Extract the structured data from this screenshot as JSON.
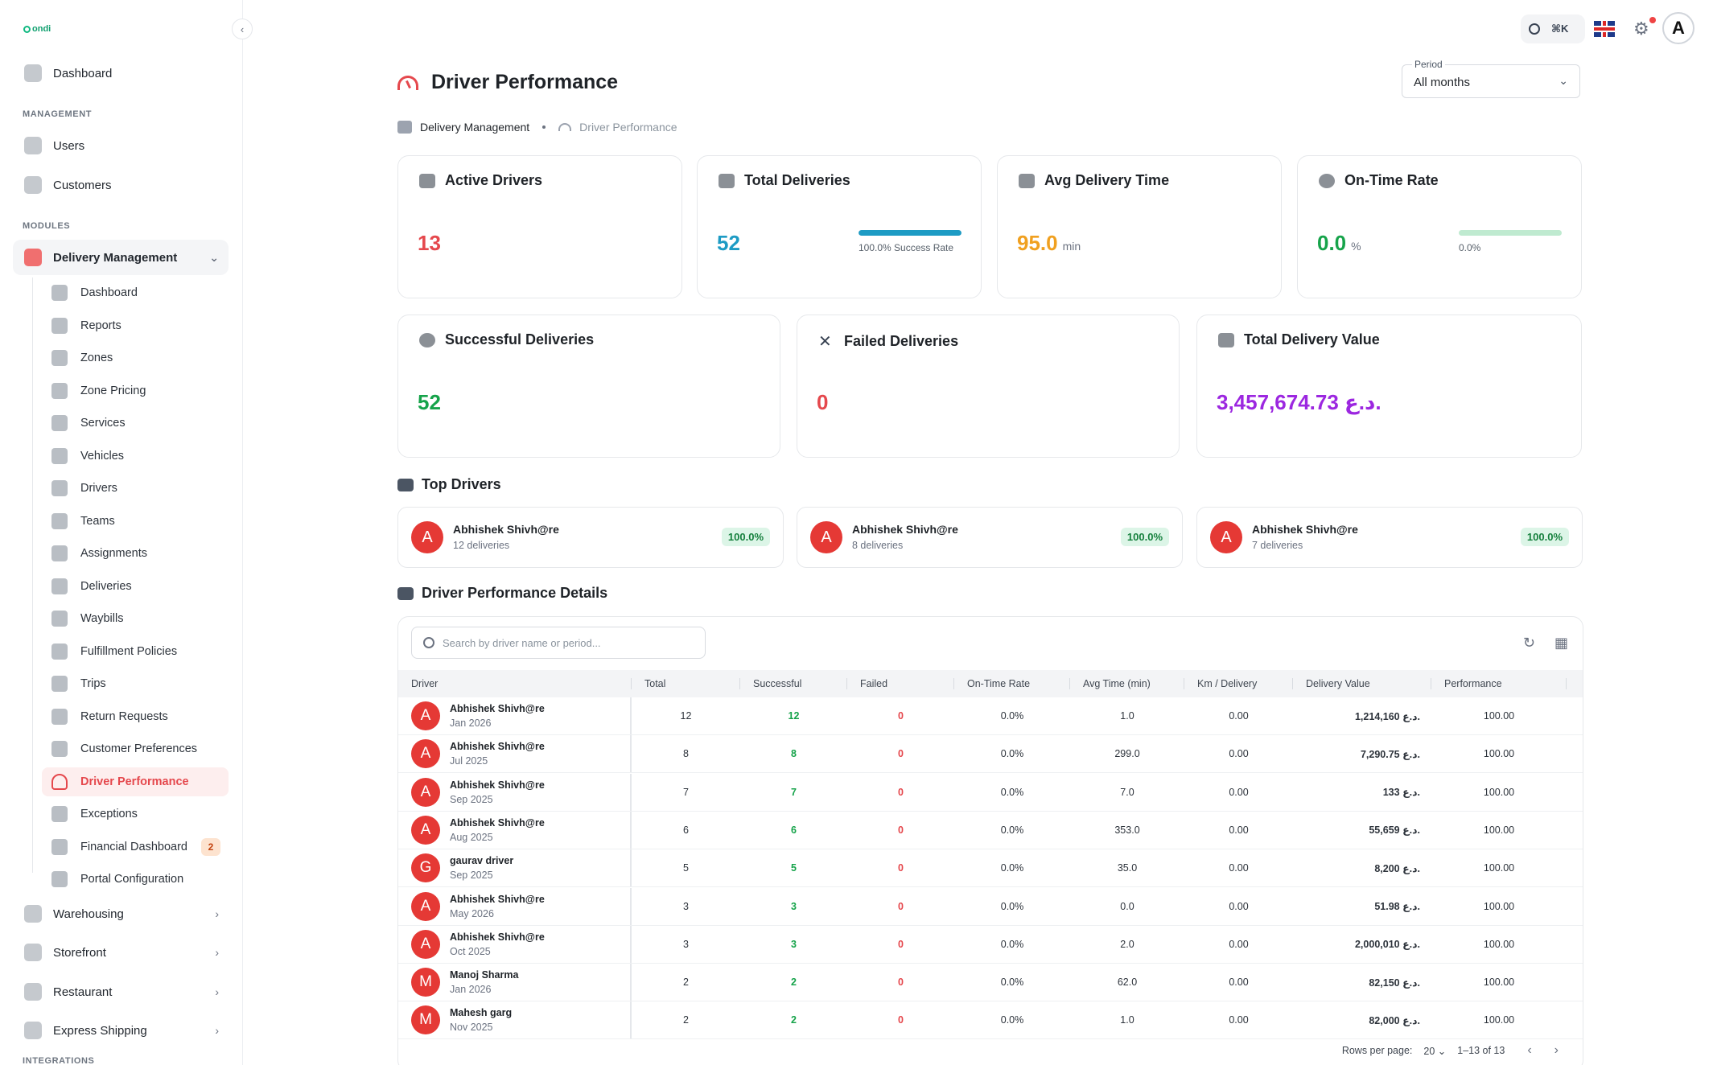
{
  "brand": {
    "logo_text": "ondi"
  },
  "sidebar": {
    "dashboard": "Dashboard",
    "management_label": "MANAGEMENT",
    "users": "Users",
    "customers": "Customers",
    "modules_label": "MODULES",
    "delivery_management": "Delivery Management",
    "sub_items": [
      {
        "label": "Dashboard"
      },
      {
        "label": "Reports"
      },
      {
        "label": "Zones"
      },
      {
        "label": "Zone Pricing"
      },
      {
        "label": "Services"
      },
      {
        "label": "Vehicles"
      },
      {
        "label": "Drivers"
      },
      {
        "label": "Teams"
      },
      {
        "label": "Assignments"
      },
      {
        "label": "Deliveries"
      },
      {
        "label": "Waybills"
      },
      {
        "label": "Fulfillment Policies"
      },
      {
        "label": "Trips"
      },
      {
        "label": "Return Requests"
      },
      {
        "label": "Customer Preferences"
      },
      {
        "label": "Driver Performance"
      },
      {
        "label": "Exceptions"
      },
      {
        "label": "Financial Dashboard",
        "badge": "2"
      },
      {
        "label": "Portal Configuration"
      }
    ],
    "warehousing": "Warehousing",
    "storefront": "Storefront",
    "restaurant": "Restaurant",
    "express_shipping": "Express Shipping",
    "integrations_label": "INTEGRATIONS"
  },
  "topbar": {
    "shortcut": "⌘K",
    "avatar_letter": "A"
  },
  "header": {
    "title": "Driver Performance",
    "period_label": "Period",
    "period_value": "All months"
  },
  "breadcrumb": {
    "parent": "Delivery Management",
    "current": "Driver Performance"
  },
  "stats": {
    "active_drivers": {
      "label": "Active Drivers",
      "value": "13"
    },
    "total_deliveries": {
      "label": "Total Deliveries",
      "value": "52",
      "bar_text": "100.0% Success Rate",
      "bar_fraction": 1.0
    },
    "avg_delivery_time": {
      "label": "Avg Delivery Time",
      "value": "95.0",
      "unit": "min"
    },
    "on_time_rate": {
      "label": "On-Time Rate",
      "value": "0.0",
      "unit": "%",
      "bar_text": "0.0%",
      "bar_fraction": 0.0
    },
    "successful": {
      "label": "Successful Deliveries",
      "value": "52"
    },
    "failed": {
      "label": "Failed Deliveries",
      "value": "0"
    },
    "total_value": {
      "label": "Total Delivery Value",
      "value": "3,457,674.73 د.ع."
    }
  },
  "colors": {
    "red": "#e5484d",
    "teal": "#1d9bc4",
    "orange": "#f0a020",
    "green": "#16a34a",
    "purple": "#9c27e0",
    "light_green": "#bfead0"
  },
  "top_drivers": {
    "title": "Top Drivers",
    "items": [
      {
        "avatar": "A",
        "name": "Abhishek Shivh@re",
        "sub": "12 deliveries",
        "pct": "100.0%"
      },
      {
        "avatar": "A",
        "name": "Abhishek Shivh@re",
        "sub": "8 deliveries",
        "pct": "100.0%"
      },
      {
        "avatar": "A",
        "name": "Abhishek Shivh@re",
        "sub": "7 deliveries",
        "pct": "100.0%"
      }
    ]
  },
  "details": {
    "title": "Driver Performance Details",
    "search_placeholder": "Search by driver name or period...",
    "columns": [
      "Driver",
      "Total",
      "Successful",
      "Failed",
      "On-Time Rate",
      "Avg Time (min)",
      "Km / Delivery",
      "Delivery Value",
      "Performance"
    ],
    "rows": [
      {
        "avatar": "A",
        "name": "Abhishek Shivh@re",
        "period": "Jan 2026",
        "total": "12",
        "successful": "12",
        "failed": "0",
        "on_time": "0.0%",
        "avg_time": "1.0",
        "km": "0.00",
        "value": "1,214,160 د.ع.",
        "perf": "100.00"
      },
      {
        "avatar": "A",
        "name": "Abhishek Shivh@re",
        "period": "Jul 2025",
        "total": "8",
        "successful": "8",
        "failed": "0",
        "on_time": "0.0%",
        "avg_time": "299.0",
        "km": "0.00",
        "value": "7,290.75 د.ع.",
        "perf": "100.00"
      },
      {
        "avatar": "A",
        "name": "Abhishek Shivh@re",
        "period": "Sep 2025",
        "total": "7",
        "successful": "7",
        "failed": "0",
        "on_time": "0.0%",
        "avg_time": "7.0",
        "km": "0.00",
        "value": "133 د.ع.",
        "perf": "100.00"
      },
      {
        "avatar": "A",
        "name": "Abhishek Shivh@re",
        "period": "Aug 2025",
        "total": "6",
        "successful": "6",
        "failed": "0",
        "on_time": "0.0%",
        "avg_time": "353.0",
        "km": "0.00",
        "value": "55,659 د.ع.",
        "perf": "100.00"
      },
      {
        "avatar": "G",
        "name": "gaurav driver",
        "period": "Sep 2025",
        "total": "5",
        "successful": "5",
        "failed": "0",
        "on_time": "0.0%",
        "avg_time": "35.0",
        "km": "0.00",
        "value": "8,200 د.ع.",
        "perf": "100.00"
      },
      {
        "avatar": "A",
        "name": "Abhishek Shivh@re",
        "period": "May 2026",
        "total": "3",
        "successful": "3",
        "failed": "0",
        "on_time": "0.0%",
        "avg_time": "0.0",
        "km": "0.00",
        "value": "51.98 د.ع.",
        "perf": "100.00"
      },
      {
        "avatar": "A",
        "name": "Abhishek Shivh@re",
        "period": "Oct 2025",
        "total": "3",
        "successful": "3",
        "failed": "0",
        "on_time": "0.0%",
        "avg_time": "2.0",
        "km": "0.00",
        "value": "2,000,010 د.ع.",
        "perf": "100.00"
      },
      {
        "avatar": "M",
        "name": "Manoj Sharma",
        "period": "Jan 2026",
        "total": "2",
        "successful": "2",
        "failed": "0",
        "on_time": "0.0%",
        "avg_time": "62.0",
        "km": "0.00",
        "value": "82,150 د.ع.",
        "perf": "100.00"
      },
      {
        "avatar": "M",
        "name": "Mahesh garg",
        "period": "Nov 2025",
        "total": "2",
        "successful": "2",
        "failed": "0",
        "on_time": "0.0%",
        "avg_time": "1.0",
        "km": "0.00",
        "value": "82,000 د.ع.",
        "perf": "100.00"
      }
    ],
    "rows_per_page_label": "Rows per page:",
    "rows_per_page": "20",
    "range": "1–13 of 13"
  }
}
